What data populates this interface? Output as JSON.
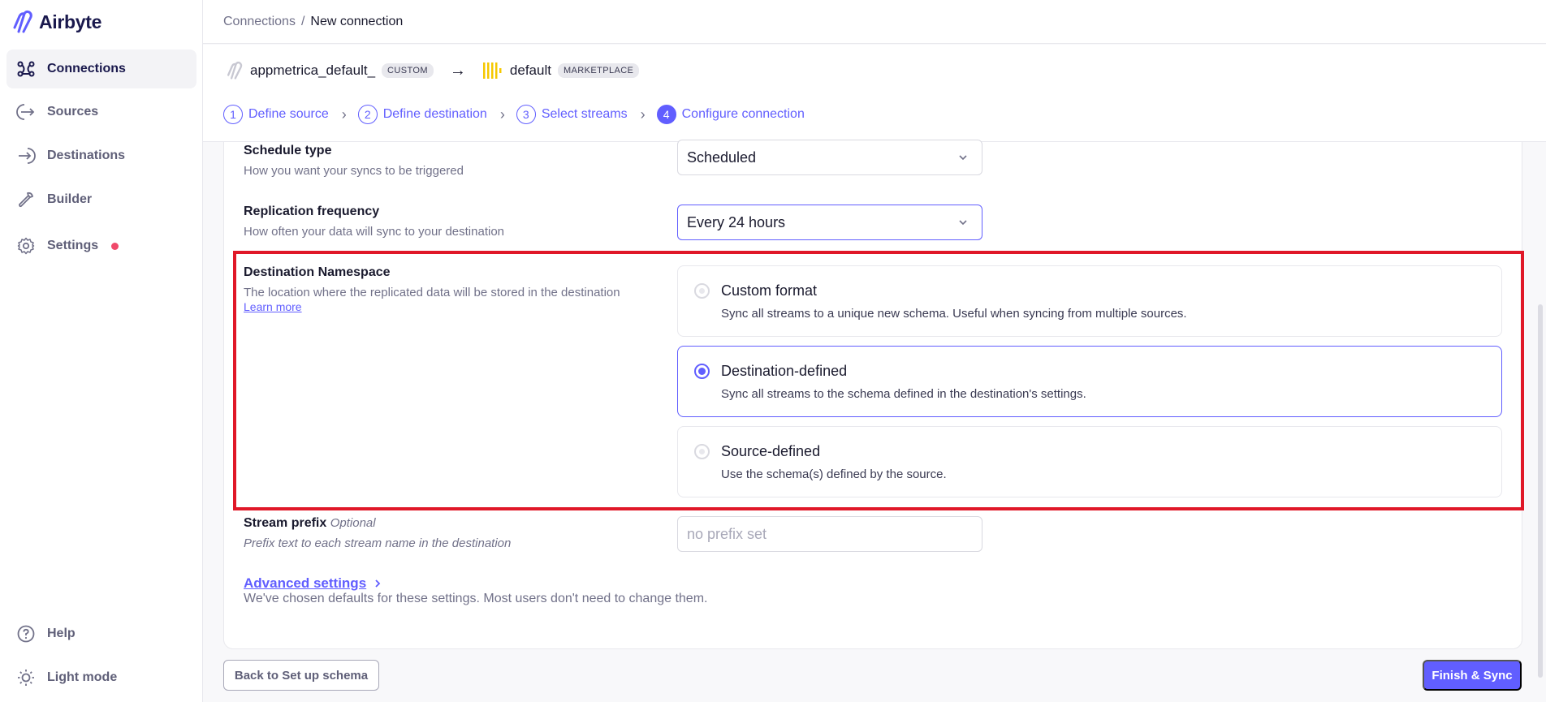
{
  "app": {
    "name": "Airbyte"
  },
  "sidebar": {
    "items": [
      {
        "label": "Connections",
        "icon": "connections-icon"
      },
      {
        "label": "Sources",
        "icon": "sources-icon"
      },
      {
        "label": "Destinations",
        "icon": "destinations-icon"
      },
      {
        "label": "Builder",
        "icon": "builder-icon"
      },
      {
        "label": "Settings",
        "icon": "gear-icon"
      }
    ],
    "bottom": [
      {
        "label": "Help",
        "icon": "help-icon"
      },
      {
        "label": "Light mode",
        "icon": "sun-icon"
      }
    ]
  },
  "breadcrumb": {
    "parent": "Connections",
    "separator": "/",
    "current": "New connection"
  },
  "connection": {
    "source_name": "appmetrica_default_",
    "source_badge": "CUSTOM",
    "destination_name": "default",
    "destination_badge": "MARKETPLACE"
  },
  "steps": [
    {
      "num": "1",
      "label": "Define source"
    },
    {
      "num": "2",
      "label": "Define destination"
    },
    {
      "num": "3",
      "label": "Select streams"
    },
    {
      "num": "4",
      "label": "Configure connection"
    }
  ],
  "form": {
    "schedule_type": {
      "label": "Schedule type",
      "desc": "How you want your syncs to be triggered",
      "value": "Scheduled"
    },
    "replication_frequency": {
      "label": "Replication frequency",
      "desc": "How often your data will sync to your destination",
      "value": "Every 24 hours"
    },
    "namespace": {
      "label": "Destination Namespace",
      "desc": "The location where the replicated data will be stored in the destination",
      "learn_more": "Learn more",
      "options": [
        {
          "title": "Custom format",
          "desc": "Sync all streams to a unique new schema. Useful when syncing from multiple sources."
        },
        {
          "title": "Destination-defined",
          "desc": "Sync all streams to the schema defined in the destination's settings."
        },
        {
          "title": "Source-defined",
          "desc": "Use the schema(s) defined by the source."
        }
      ]
    },
    "stream_prefix": {
      "label": "Stream prefix",
      "optional": "Optional",
      "desc": "Prefix text to each stream name in the destination",
      "placeholder": "no prefix set"
    },
    "advanced": {
      "label": "Advanced settings",
      "desc": "We've chosen defaults for these settings. Most users don't need to change them."
    }
  },
  "buttons": {
    "back": "Back to Set up schema",
    "finish": "Finish & Sync"
  },
  "colors": {
    "accent": "#615eff",
    "highlight": "#e01828",
    "notification": "#f0496a"
  }
}
